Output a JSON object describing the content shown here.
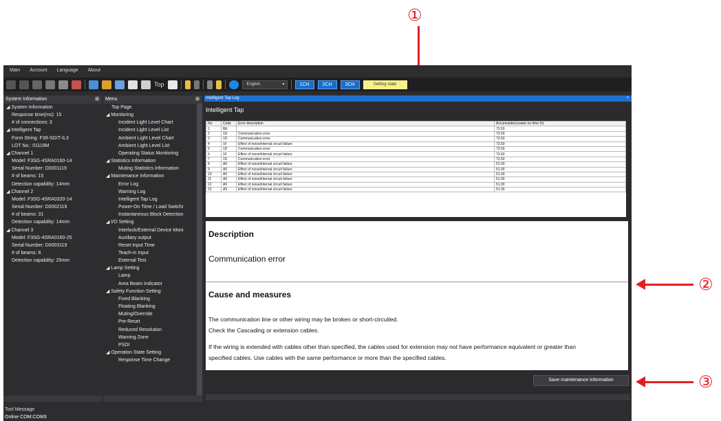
{
  "callouts": {
    "c1": "①",
    "c2": "②",
    "c3": "③"
  },
  "menubar": [
    "Main",
    "Account",
    "Language",
    "About"
  ],
  "toolbar": {
    "top_label": "Top",
    "language": "English",
    "ch1": "1CH",
    "ch2": "2CH",
    "ch3": "3CH",
    "setting_state": "Setting state"
  },
  "system_info": {
    "title": "System Information",
    "rows": [
      "◢ System Information",
      "Response time(ms): 15",
      "# of connections: 3",
      "◢ Intelligent Tap",
      "Form String: F39-SGIT-IL3",
      "LOT No.: 01119M",
      "◢ Channel 1",
      "Model: F3SG-4SRA0160-14",
      "Serial Number: D0001119",
      "# of beams: 15",
      "Detection capability: 14mm",
      "◢ Channel 2",
      "Model: F3SG-4SRA0320-14",
      "Serial Number: D0002119",
      "# of beams: 31",
      "Detection capability: 14mm",
      "◢ Channel 3",
      "Model: F3SG-4SRA0160-25",
      "Serial Number: D0003119",
      "# of beams: 8",
      "Detection capability: 25mm"
    ],
    "indent": [
      0,
      1,
      1,
      0,
      1,
      1,
      0,
      1,
      1,
      1,
      1,
      0,
      1,
      1,
      1,
      1,
      0,
      1,
      1,
      1,
      1
    ]
  },
  "menu": {
    "title": "Menu",
    "rows": [
      "Top Page",
      "◢ Monitoring",
      "Incident Light Level Chart",
      "Incident Light Level List",
      "Ambient Light Level Chart",
      "Ambient Light Level List",
      "Operating Status Monitoring",
      "◢ Statistics Information",
      "Muting Statistics Information",
      "◢ Maintenance Information",
      "Error Log",
      "Warning Log",
      "Intelligent Tap Log",
      "Power-On Time / Load Switchi",
      "Instantaneous Block Detection",
      "◢ I/O Setting",
      "Interlock/External Device Moni",
      "Auxiliary output",
      "Reset Input Time",
      "Teach-in Input",
      "External Test",
      "◢ Lamp Setting",
      "Lamp",
      "Area Beam Indicator",
      "◢ Safety Function Setting",
      "Fixed Blanking",
      "Floating Blanking",
      "Muting/Override",
      "Pre-Reset",
      "Reduced Resolution",
      "Warning Zone",
      "PSDI",
      "◢ Operation State Setting",
      "Response Time Change"
    ],
    "indent": [
      1,
      0,
      2,
      2,
      2,
      2,
      2,
      0,
      2,
      0,
      2,
      2,
      2,
      2,
      2,
      0,
      2,
      2,
      2,
      2,
      2,
      0,
      2,
      2,
      0,
      2,
      2,
      2,
      2,
      2,
      2,
      2,
      0,
      2
    ]
  },
  "log": {
    "window_title": "Intelligent Tap Log",
    "heading": "Intelligent Tap",
    "columns": [
      "No.",
      "Code",
      "Error description",
      "Accumulated power-on time (h)"
    ],
    "rows": [
      [
        "1",
        "BE",
        "",
        "73.50"
      ],
      [
        "2",
        "1D",
        "Communication error",
        "73.50"
      ],
      [
        "3",
        "1D",
        "Communication error",
        "73.50"
      ],
      [
        "4",
        "1F",
        "Effect of noise/internal circuit failure",
        "73.50"
      ],
      [
        "5",
        "1D",
        "Communication error",
        "73.50"
      ],
      [
        "6",
        "1F",
        "Effect of noise/internal circuit failure",
        "73.50"
      ],
      [
        "7",
        "1D",
        "Communication error",
        "73.50"
      ],
      [
        "8",
        "A5",
        "Effect of noise/internal circuit failure",
        "51.00"
      ],
      [
        "9",
        "A5",
        "Effect of noise/internal circuit failure",
        "51.00"
      ],
      [
        "10",
        "A5",
        "Effect of noise/internal circuit failure",
        "51.00"
      ],
      [
        "11",
        "A5",
        "Effect of noise/internal circuit failure",
        "51.00"
      ],
      [
        "12",
        "A5",
        "Effect of noise/internal circuit failure",
        "51.00"
      ],
      [
        "13",
        "A5",
        "Effect of noise/internal circuit failure",
        "51.00"
      ]
    ]
  },
  "detail": {
    "description_heading": "Description",
    "description": "Communication error",
    "cause_heading": "Cause and measures",
    "cause_line1": "The communication line or other wiring may be broken or short-circuited.",
    "cause_line2": "Check the Cascading or extension cables.",
    "cause_line3": "If the wiring is extended with cables other than specified, the cables used for extension may not have performance equivalent or greater than",
    "cause_line4": "specified cables. Use cables with the same performance or more than the specified cables."
  },
  "save_button": "Save maintenance information",
  "status": {
    "tool_message": "Tool Message",
    "online": "Online   COM:COM3"
  }
}
